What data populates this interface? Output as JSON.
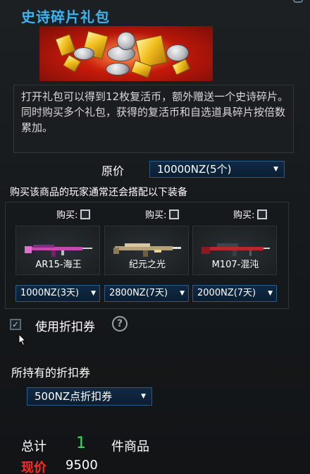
{
  "package": {
    "title": "史诗碎片礼包",
    "description": "打开礼包可以得到12枚复活币，额外赠送一个史诗碎片。同时购买多个礼包，获得的复活币和自选道具碎片按倍数累加。"
  },
  "price": {
    "label": "原价",
    "selected": "10000NZ(5个)"
  },
  "recommend": {
    "title": "购买该商品的玩家通常还会搭配以下装备",
    "buy_label": "购买:",
    "items": [
      {
        "name": "AR15-海王",
        "price": "1000NZ(3天)",
        "checked": false
      },
      {
        "name": "纪元之光",
        "price": "2800NZ(7天)",
        "checked": false
      },
      {
        "name": "M107-混沌",
        "price": "2000NZ(7天)",
        "checked": false
      }
    ]
  },
  "discount": {
    "label": "使用折扣券",
    "checked": true,
    "help": "?",
    "owned_label": "所持有的折扣券",
    "selected_coupon": "500NZ点折扣券"
  },
  "summary": {
    "total_label": "总计",
    "count": "1",
    "unit_label": "件商品",
    "now_label": "现价",
    "now_value": "9500"
  },
  "colors": {
    "title": "#3cb4f0",
    "count": "#36e05a",
    "now_label": "#ff2a2a",
    "select_bg": "#0a1e33"
  }
}
